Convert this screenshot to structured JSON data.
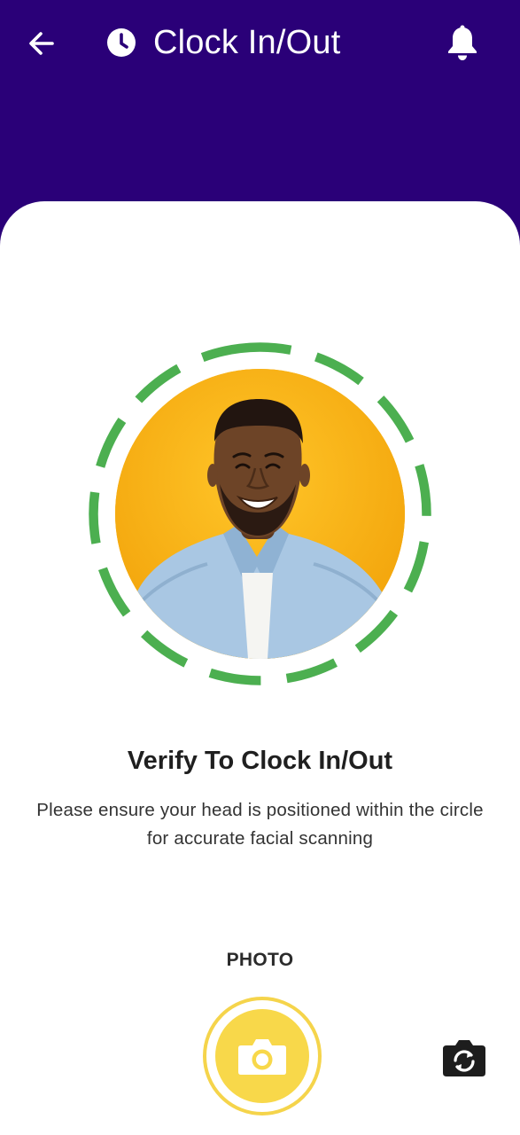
{
  "header": {
    "title": "Clock In/Out",
    "back_icon": "arrow-left-icon",
    "title_icon": "clock-icon",
    "notification_icon": "bell-icon"
  },
  "verification": {
    "title": "Verify To Clock In/Out",
    "description": "Please ensure your head is positioned within the circle for accurate facial scanning",
    "ring_color": "#4caf50",
    "photo_background": "#f7b215"
  },
  "capture": {
    "mode_label": "PHOTO",
    "shutter_icon": "camera-icon",
    "switch_icon": "camera-switch-icon",
    "accent_color": "#f8d84a"
  },
  "colors": {
    "header_background": "#2a0078",
    "sheet_background": "#ffffff"
  }
}
